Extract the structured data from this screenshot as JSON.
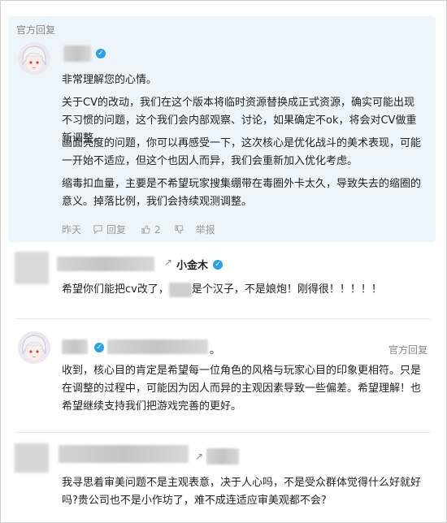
{
  "official_block": {
    "tag": "官方回复",
    "greeting": "非常理解您的心情。",
    "paragraphs": [
      "关于CV的改动，我们在这个版本将临时资源替换成正式资源，确实可能出现不习惯的问题，这个我们会内部观察、讨论，如果确定不ok，将会对CV做重新调整。",
      "画面亮度的问题，你可以再感受一下，这次核心是优化战斗的美术表现，可能一开始不适应，但这个也因人而异，我们会重新加入优化考虑。",
      "缩毒扣血量，主要是不希望玩家搜集绷带在毒圈外卡太久，导致失去的缩圈的意义。掉落比例，我们会持续观测调整。"
    ],
    "actions": {
      "time": "昨天",
      "reply": "回复",
      "likes": "2",
      "report": "举报"
    }
  },
  "comment1": {
    "arrow": "↗",
    "target_name": "小金木",
    "text_before": "希望你们能把cv改了，",
    "text_after": "是个汉子，不是娘炮！刚得很！！！！！"
  },
  "official_reply2": {
    "tag": "官方回复",
    "name_suffix": "。",
    "text": "收到，核心目的肯定是希望每一位角色的风格与玩家心目的印象更相符。只是在调整的过程中，可能因为因人而异的主观因素导致一些偏差。希望理解！也希望继续支持我们把游戏完善的更好。"
  },
  "comment3": {
    "arrow": "↗",
    "text": "我寻思着审美问题不是主观表意，决于人心吗，不是受众群体觉得什么好就好吗?贵公司也不是小作坊了，难不成连适应审美观都不会?"
  }
}
